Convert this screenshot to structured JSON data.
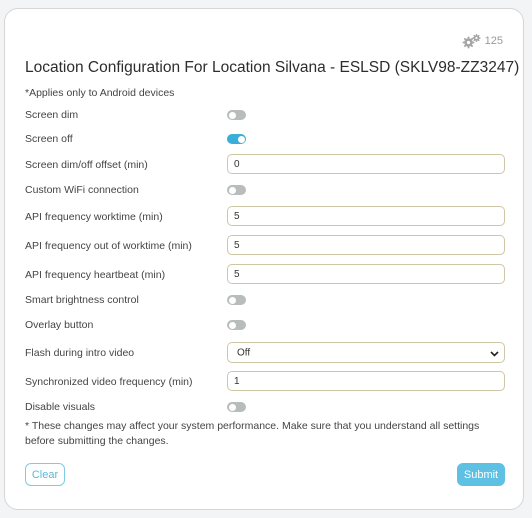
{
  "header": {
    "badge_count": "125",
    "badge_icon": "gears-icon",
    "title": "Location Configuration For Location Silvana - ESLSD (SKLV98-ZZ3247)",
    "note": "*Applies only to Android devices"
  },
  "fields": {
    "screen_dim": {
      "label": "Screen dim",
      "enabled": false
    },
    "screen_off": {
      "label": "Screen off",
      "enabled": true
    },
    "screen_offset": {
      "label": "Screen dim/off offset (min)",
      "value": "0"
    },
    "custom_wifi": {
      "label": "Custom WiFi connection",
      "enabled": false
    },
    "api_worktime": {
      "label": "API frequency worktime (min)",
      "value": "5"
    },
    "api_out_worktime": {
      "label": "API frequency out of worktime (min)",
      "value": "5"
    },
    "api_heartbeat": {
      "label": "API frequency heartbeat (min)",
      "value": "5"
    },
    "smart_brightness": {
      "label": "Smart brightness control",
      "enabled": false
    },
    "overlay_button": {
      "label": "Overlay button",
      "enabled": false
    },
    "flash_intro": {
      "label": "Flash during intro video",
      "value": "Off"
    },
    "sync_video_freq": {
      "label": "Synchronized video frequency (min)",
      "value": "1"
    },
    "disable_visuals": {
      "label": "Disable visuals",
      "enabled": false
    }
  },
  "warning": "* These changes may affect your system performance. Make sure that you understand all settings before submitting the changes.",
  "buttons": {
    "clear": "Clear",
    "submit": "Submit"
  },
  "colors": {
    "accent": "#5ec0e3",
    "toggle_on": "#3aaed8",
    "toggle_off": "#b9bcbc",
    "input_border": "#cfc6a6"
  }
}
